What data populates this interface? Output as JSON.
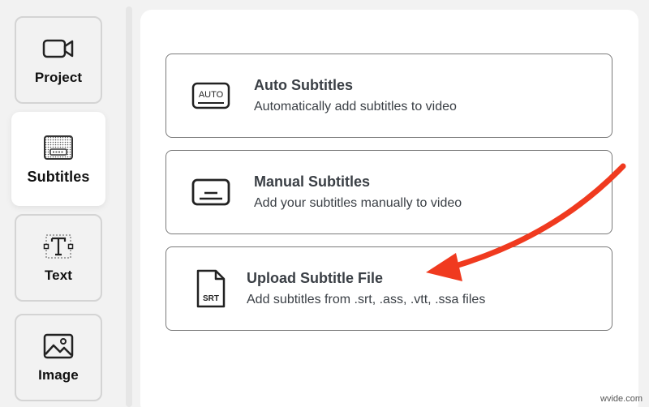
{
  "sidebar": {
    "items": [
      {
        "label": "Project",
        "icon": "video-camera-icon"
      },
      {
        "label": "Subtitles",
        "icon": "subtitles-icon",
        "active": true
      },
      {
        "label": "Text",
        "icon": "text-box-icon"
      },
      {
        "label": "Image",
        "icon": "image-icon"
      }
    ]
  },
  "options": [
    {
      "title": "Auto Subtitles",
      "description": "Automatically add subtitles to video",
      "icon": "auto-subtitles-icon",
      "icon_text": "AUTO"
    },
    {
      "title": "Manual Subtitles",
      "description": "Add your subtitles manually to video",
      "icon": "manual-subtitles-icon"
    },
    {
      "title": "Upload Subtitle File",
      "description": "Add subtitles from .srt, .ass, .vtt, .ssa files",
      "icon": "srt-file-icon",
      "icon_text": "SRT"
    }
  ],
  "watermark": "wvide.com",
  "colors": {
    "arrow": "#f03a1f",
    "text": "#3a3f45",
    "border": "#7a7a7a"
  }
}
